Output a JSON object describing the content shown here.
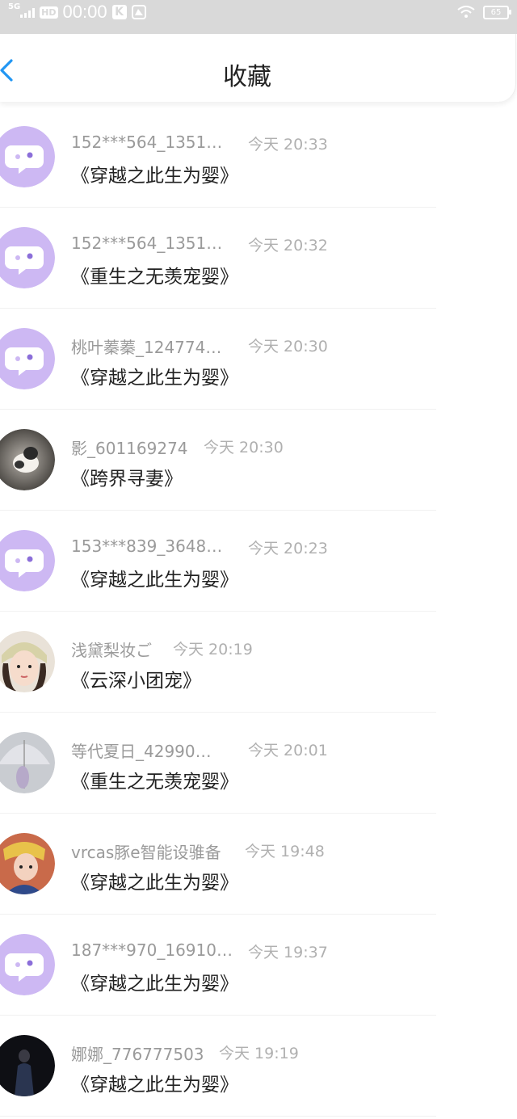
{
  "status_bar": {
    "network": "5G",
    "hd": "HD",
    "time": "00:00",
    "k": "K",
    "battery": "65"
  },
  "nav": {
    "title": "收藏",
    "back_icon": "chevron-left-icon",
    "accent": "#2196f3"
  },
  "items": [
    {
      "name": "152***564_1351…",
      "time": "今天 20:33",
      "title": "《穿越之此生为婴》",
      "avatar": "default-chat-avatar"
    },
    {
      "name": "152***564_1351…",
      "time": "今天 20:32",
      "title": "《重生之无羡宠婴》",
      "avatar": "default-chat-avatar"
    },
    {
      "name": "桃叶蓁蓁_124774…",
      "time": "今天 20:30",
      "title": "《穿越之此生为婴》",
      "avatar": "default-chat-avatar"
    },
    {
      "name": "影_601169274",
      "time": "今天 20:30",
      "title": "《跨界寻妻》",
      "avatar": "kitten-photo"
    },
    {
      "name": "153***839_3648…",
      "time": "今天 20:23",
      "title": "《穿越之此生为婴》",
      "avatar": "default-chat-avatar"
    },
    {
      "name": "浅黛梨妆ご",
      "time": "今天 20:19",
      "title": "《云深小团宠》",
      "avatar": "girl-photo"
    },
    {
      "name": "等代夏日_42990…",
      "time": "今天 20:01",
      "title": "《重生之无羡宠婴》",
      "avatar": "umbrella-photo"
    },
    {
      "name": "vrcas豚e智能设骓备",
      "time": "今天 19:48",
      "title": "《穿越之此生为婴》",
      "avatar": "costume-photo"
    },
    {
      "name": "187***970_16910…",
      "time": "今天 19:37",
      "title": "《穿越之此生为婴》",
      "avatar": "default-chat-avatar"
    },
    {
      "name": "娜娜_776777503",
      "time": "今天 19:19",
      "title": "《穿越之此生为婴》",
      "avatar": "dark-figure-photo"
    }
  ]
}
